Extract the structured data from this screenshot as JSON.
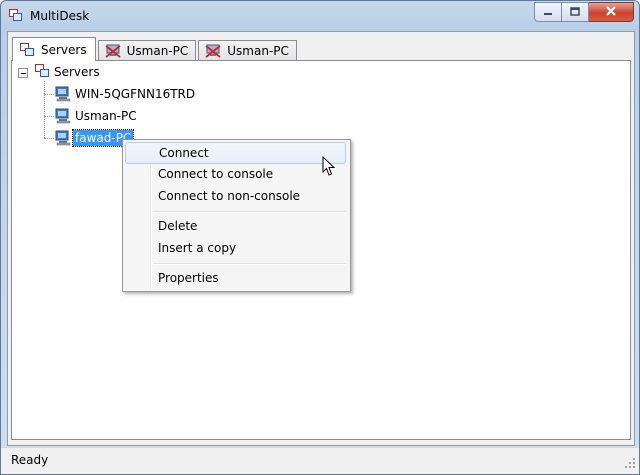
{
  "window": {
    "title": "MultiDesk",
    "app_icon": "multidesk-icon",
    "caption_buttons": [
      "minimize",
      "maximize",
      "close"
    ]
  },
  "tabs": [
    {
      "label": "Servers",
      "icon": "servers-icon",
      "active": true
    },
    {
      "label": "Usman-PC",
      "icon": "disconnected-computer-icon",
      "active": false
    },
    {
      "label": "Usman-PC",
      "icon": "disconnected-computer-icon",
      "active": false
    }
  ],
  "tree": {
    "root": {
      "label": "Servers",
      "icon": "servers-icon",
      "expanded": true
    },
    "children": [
      {
        "label": "WIN-5QGFNN16TRD",
        "icon": "computer-icon"
      },
      {
        "label": "Usman-PC",
        "icon": "computer-icon"
      },
      {
        "label": "fawad-PC",
        "icon": "computer-icon",
        "selected": true
      }
    ]
  },
  "context_menu": {
    "groups": [
      [
        "Connect",
        "Connect to console",
        "Connect to non-console"
      ],
      [
        "Delete",
        "Insert a copy"
      ],
      [
        "Properties"
      ]
    ],
    "hovered": "Connect"
  },
  "status": {
    "text": "Ready"
  },
  "colors": {
    "selection": "#3399ff",
    "menu_hover_border": "#aecff7",
    "close_button": "#c8442c"
  }
}
